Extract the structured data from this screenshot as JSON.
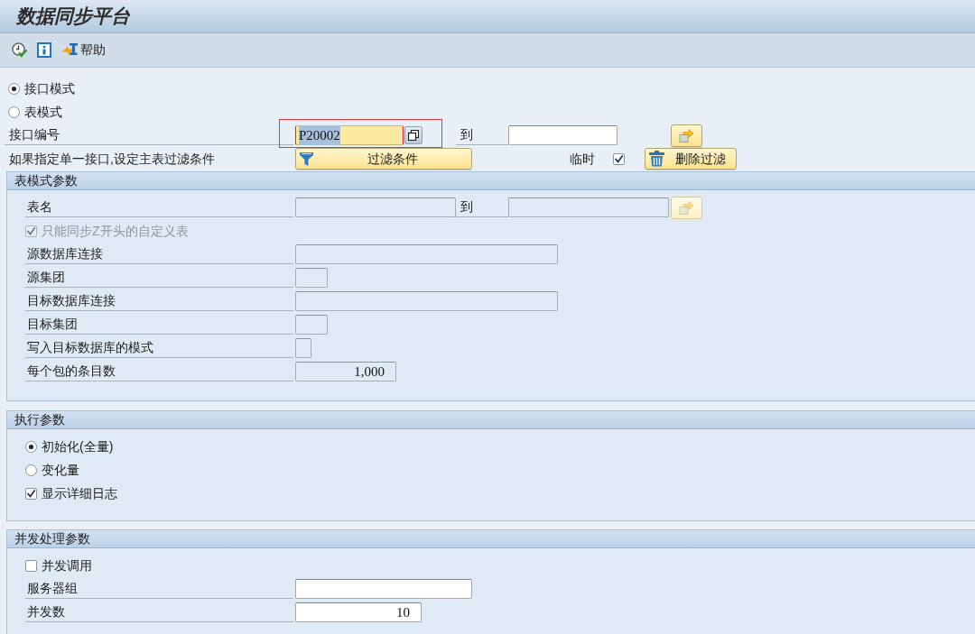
{
  "window": {
    "title": "数据同步平台"
  },
  "toolbar": {
    "help_label": "帮助"
  },
  "selection": {
    "modes": [
      {
        "label": "接口模式",
        "selected": true
      },
      {
        "label": "表模式",
        "selected": false
      }
    ],
    "interface": {
      "label": "接口编号",
      "value": "P20002",
      "focused": true,
      "marked": true,
      "to_label": "到"
    },
    "filter": {
      "label": "如果指定单一接口,设定主表过滤条件",
      "button": "过滤条件",
      "temp_label": "临时",
      "temp_checked": true,
      "delete_button": "删除过滤"
    }
  },
  "sections": [
    {
      "title": "表模式参数",
      "rows": [
        {
          "kind": "range",
          "label": "表名",
          "to_label": "到",
          "disabled": true
        },
        {
          "kind": "checkbox",
          "label": "只能同步Z开头的自定义表",
          "checked": true,
          "disabled": true
        },
        {
          "kind": "field",
          "label": "源数据库连接",
          "disabled": true
        },
        {
          "kind": "field",
          "label": "源集团",
          "disabled": true
        },
        {
          "kind": "field",
          "label": "目标数据库连接",
          "disabled": true
        },
        {
          "kind": "field",
          "label": "目标集团",
          "disabled": true
        },
        {
          "kind": "field",
          "label": "写入目标数据库的模式",
          "disabled": true
        },
        {
          "kind": "number",
          "label": "每个包的条目数",
          "value": "1,000",
          "disabled": true
        }
      ]
    },
    {
      "title": "执行参数",
      "rows": [
        {
          "kind": "radio",
          "label": "初始化(全量)",
          "selected": true,
          "disabled": false
        },
        {
          "kind": "radio",
          "label": "变化量",
          "selected": false,
          "disabled": false
        },
        {
          "kind": "checkbox",
          "label": "显示详细日志",
          "checked": true,
          "disabled": false
        }
      ]
    },
    {
      "title": "并发处理参数",
      "rows": [
        {
          "kind": "checkbox",
          "label": "并发调用",
          "checked": false,
          "disabled": false
        },
        {
          "kind": "field",
          "label": "服务器组",
          "disabled": false
        },
        {
          "kind": "number",
          "label": "并发数",
          "value": "10",
          "disabled": false
        }
      ]
    }
  ]
}
